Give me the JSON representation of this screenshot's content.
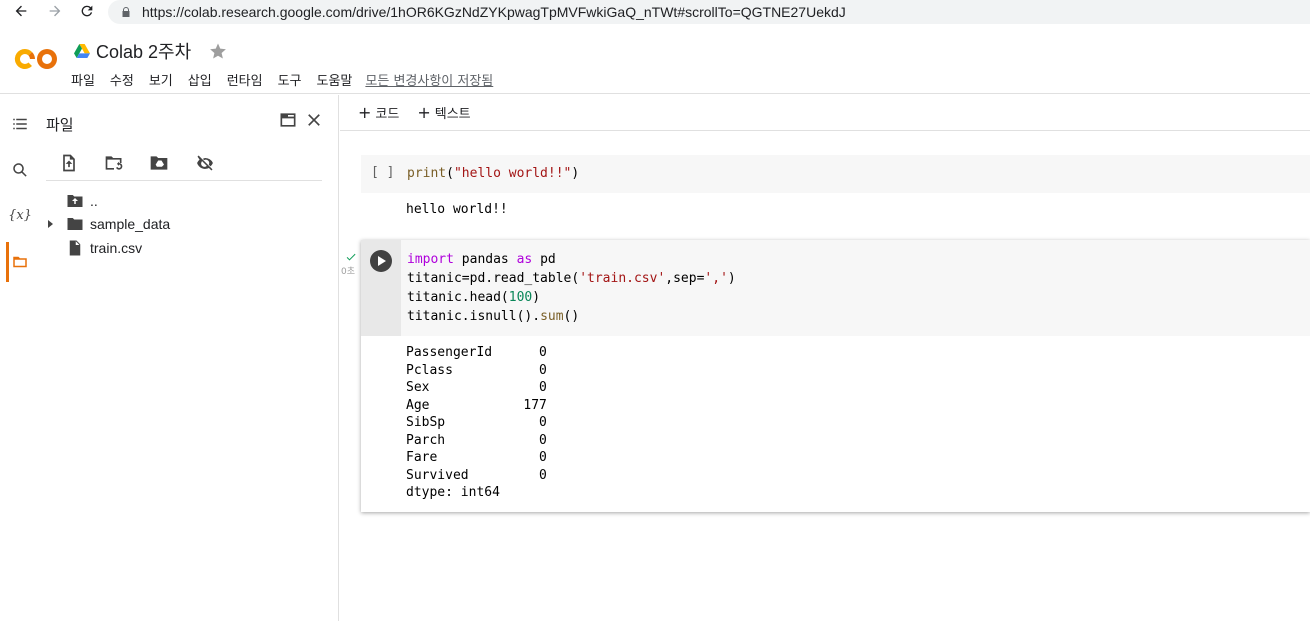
{
  "browser": {
    "url": "https://colab.research.google.com/drive/1hOR6KGzNdZYKpwagTpMVFwkiGaQ_nTWt#scrollTo=QGTNE27UekdJ"
  },
  "header": {
    "title": "Colab 2주차",
    "menu": [
      "파일",
      "수정",
      "보기",
      "삽입",
      "런타임",
      "도구",
      "도움말"
    ],
    "save_status": "모든 변경사항이 저장됨"
  },
  "rail": {
    "variables_label": "{x}"
  },
  "files_panel": {
    "title": "파일",
    "tree": [
      {
        "name": ".."
      },
      {
        "name": "sample_data"
      },
      {
        "name": "train.csv"
      }
    ]
  },
  "notebook_toolbar": {
    "add_code": "코드",
    "add_text": "텍스트"
  },
  "cells": [
    {
      "bracket": "[ ]",
      "code": "print(\"hello world!!\")",
      "output": "hello world!!"
    },
    {
      "code_lines": [
        "import pandas as pd",
        "titanic=pd.read_table('train.csv',sep=',')",
        "titanic.head(100)",
        "titanic.isnull().sum()"
      ],
      "exec_time": "0초",
      "output_lines": [
        "PassengerId      0",
        "Pclass           0",
        "Sex              0",
        "Age            177",
        "SibSp            0",
        "Parch            0",
        "Fare             0",
        "Survived         0",
        "dtype: int64"
      ]
    }
  ],
  "colors": {
    "accent": "#e8710a",
    "keyword": "#af00db",
    "string": "#a31515",
    "number": "#098658",
    "check": "#0f9d58"
  }
}
